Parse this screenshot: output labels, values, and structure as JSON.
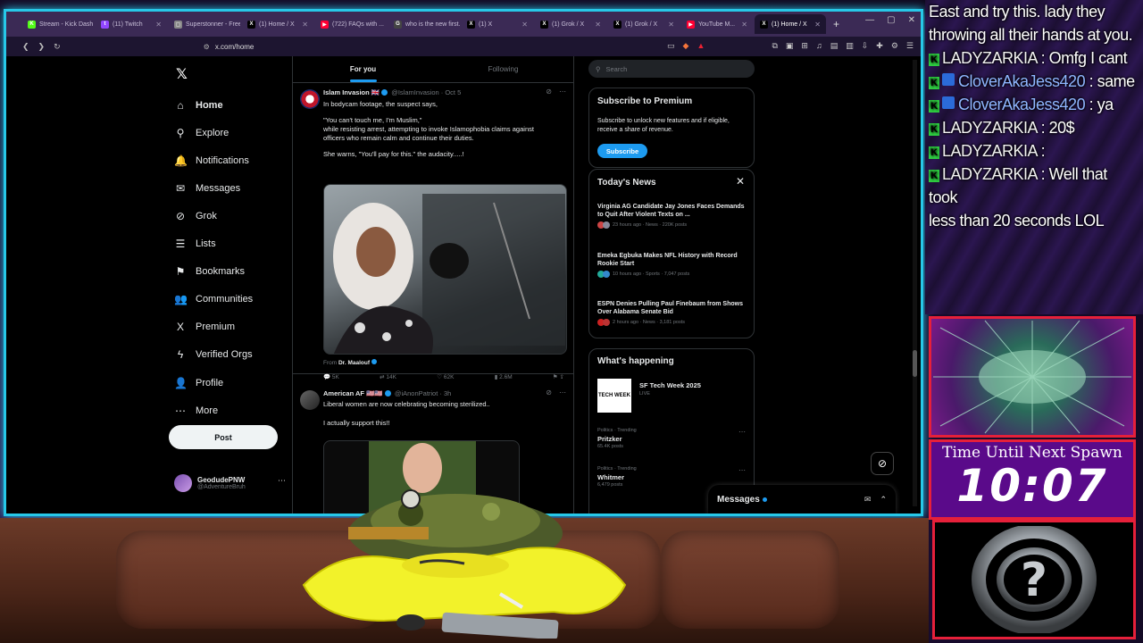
{
  "browser": {
    "tabs": [
      {
        "label": "Stream - Kick Dash",
        "color": "#53fc18",
        "icon": "kick-icon",
        "glyph": "K"
      },
      {
        "label": "(11) Twitch",
        "color": "#9146ff",
        "icon": "twitch-icon",
        "glyph": "t"
      },
      {
        "label": "Superstonner - Free",
        "color": "#888888",
        "icon": "page-icon",
        "glyph": "▢"
      },
      {
        "label": "(1) Home / X",
        "color": "#000000",
        "icon": "x-icon",
        "glyph": "X"
      },
      {
        "label": "(722) FAQs with ...",
        "color": "#ff0033",
        "icon": "youtube-icon",
        "glyph": "▶"
      },
      {
        "label": "who is the new first...",
        "color": "#444444",
        "icon": "search-icon",
        "glyph": "G"
      },
      {
        "label": "(1) X",
        "color": "#000000",
        "icon": "x-icon",
        "glyph": "X"
      },
      {
        "label": "(1) Grok / X",
        "color": "#000000",
        "icon": "x-icon",
        "glyph": "X"
      },
      {
        "label": "(1) Grok / X",
        "color": "#000000",
        "icon": "x-icon",
        "glyph": "X"
      },
      {
        "label": "YouTube M...",
        "color": "#ff0033",
        "icon": "youtube-icon",
        "glyph": "▶"
      },
      {
        "label": "(1) Home / X",
        "color": "#000000",
        "icon": "x-icon",
        "glyph": "X",
        "active": true
      }
    ],
    "url": "x.com/home"
  },
  "nav": {
    "items": [
      {
        "label": "Home",
        "icon": "⌂",
        "name": "home"
      },
      {
        "label": "Explore",
        "icon": "⚲",
        "name": "explore"
      },
      {
        "label": "Notifications",
        "icon": "🔔",
        "name": "notifications"
      },
      {
        "label": "Messages",
        "icon": "✉",
        "name": "messages"
      },
      {
        "label": "Grok",
        "icon": "⊘",
        "name": "grok"
      },
      {
        "label": "Lists",
        "icon": "☰",
        "name": "lists"
      },
      {
        "label": "Bookmarks",
        "icon": "⚑",
        "name": "bookmarks"
      },
      {
        "label": "Communities",
        "icon": "👥",
        "name": "communities"
      },
      {
        "label": "Premium",
        "icon": "X",
        "name": "premium"
      },
      {
        "label": "Verified Orgs",
        "icon": "ϟ",
        "name": "verified-orgs"
      },
      {
        "label": "Profile",
        "icon": "👤",
        "name": "profile"
      },
      {
        "label": "More",
        "icon": "⋯",
        "name": "more"
      }
    ],
    "post_label": "Post",
    "account": {
      "name": "GeodudePNW",
      "handle": "@AdventureBruh"
    }
  },
  "feed": {
    "tabs": [
      "For you",
      "Following"
    ],
    "tweets": [
      {
        "name": "Islam Invasion 🇬🇧",
        "handle": "@IslamInvasion · Oct 5",
        "lines": [
          "In bodycam footage, the suspect says,",
          "",
          "\"You can't touch me, I'm Muslim,\"",
          "while resisting arrest, attempting to invoke Islamophobia claims against",
          "officers who remain calm and continue their duties.",
          "",
          "She warns, \"You'll pay for this.\" the audacity.....!"
        ],
        "from_label": "From",
        "from_name": "Dr. Maalouf",
        "actions": {
          "replies": "5K",
          "reposts": "14K",
          "likes": "62K",
          "views": "2.6M"
        }
      },
      {
        "name": "American AF 🇺🇸🇺🇸",
        "handle": "@iAnonPatriot · 3h",
        "lines": [
          "Liberal women are now celebrating becoming sterilized..",
          "",
          "I actually support this!!"
        ]
      }
    ]
  },
  "sidebar": {
    "search_placeholder": "Search",
    "premium": {
      "title": "Subscribe to Premium",
      "text": "Subscribe to unlock new features and if eligible, receive a share of revenue.",
      "button": "Subscribe"
    },
    "news": {
      "title": "Today's News",
      "items": [
        {
          "title": "Virginia AG Candidate Jay Jones Faces Demands to Quit After Violent Texts on ...",
          "meta": "23 hours ago · News · 220K posts"
        },
        {
          "title": "Emeka Egbuka Makes NFL History with Record Rookie Start",
          "meta": "10 hours ago · Sports · 7,047 posts"
        },
        {
          "title": "ESPN Denies Pulling Paul Finebaum from Shows Over Alabama Senate Bid",
          "meta": "2 hours ago · News · 3,181 posts"
        }
      ]
    },
    "happening": {
      "title": "What's happening",
      "event": {
        "title": "SF Tech Week 2025",
        "status": "LIVE",
        "thumb": "TECH WEEK"
      },
      "trends": [
        {
          "context": "Politics · Trending",
          "title": "Pritzker",
          "count": "65.4K posts"
        },
        {
          "context": "Politics · Trending",
          "title": "Whitmer",
          "count": "6,479 posts"
        }
      ]
    }
  },
  "messages_drawer": {
    "label": "Messages"
  },
  "chat": [
    {
      "user": "",
      "text": "East and try this. lady they"
    },
    {
      "user": "",
      "text": "throwing all their hands at you."
    },
    {
      "user": "LADYZARKIA",
      "text": ": Omfg I cant"
    },
    {
      "user": "CloverAkaJess420",
      "text": ": same",
      "blue": true
    },
    {
      "user": "CloverAkaJess420",
      "text": ": ya",
      "blue": true
    },
    {
      "user": "LADYZARKIA",
      "text": ": 20$"
    },
    {
      "user": "LADYZARKIA",
      "text": ":"
    },
    {
      "user": "LADYZARKIA",
      "text": ": Well that took"
    },
    {
      "user": "",
      "text": "less than 20 seconds LOL"
    }
  ],
  "timer": {
    "label": "Time Until Next Spawn",
    "value": "10:07"
  }
}
